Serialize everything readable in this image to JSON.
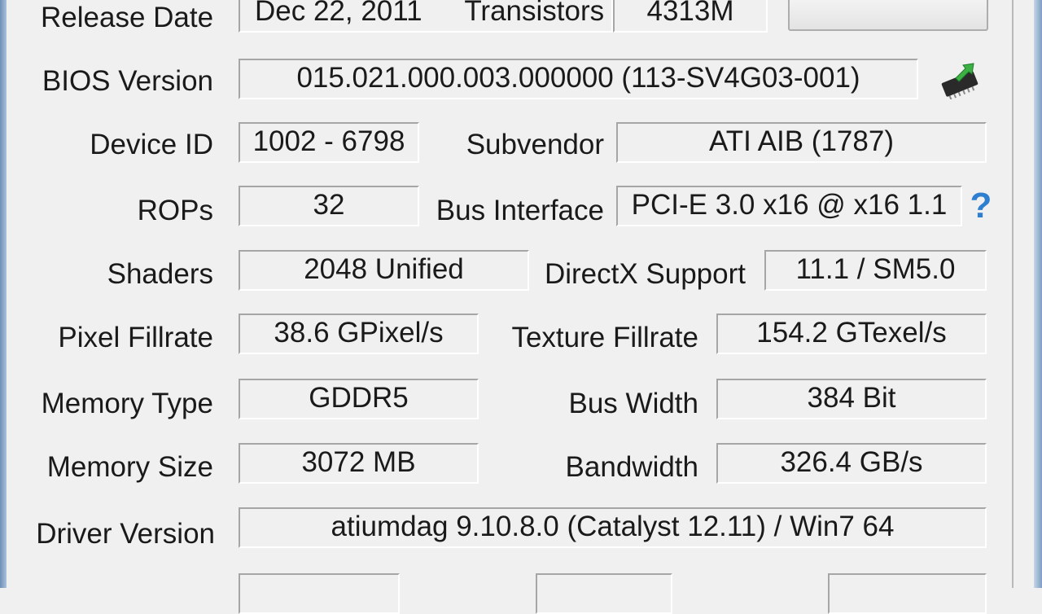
{
  "release": {
    "label": "Release Date",
    "value": "Dec 22, 2011"
  },
  "transistors": {
    "label": "Transistors",
    "value": "4313M"
  },
  "bios": {
    "label": "BIOS Version",
    "value": "015.021.000.003.000000 (113-SV4G03-001)",
    "icon": "bios-save-chip-icon"
  },
  "device_id": {
    "label": "Device ID",
    "value": "1002 - 6798"
  },
  "subvendor": {
    "label": "Subvendor",
    "value": "ATI AIB (1787)"
  },
  "rops": {
    "label": "ROPs",
    "value": "32"
  },
  "bus_interface": {
    "label": "Bus Interface",
    "value": "PCI-E 3.0 x16 @ x16 1.1",
    "help_icon": "?"
  },
  "shaders": {
    "label": "Shaders",
    "value": "2048 Unified"
  },
  "directx": {
    "label": "DirectX Support",
    "value": "11.1 / SM5.0"
  },
  "pixel_fillrate": {
    "label": "Pixel Fillrate",
    "value": "38.6 GPixel/s"
  },
  "texture_fillrate": {
    "label": "Texture Fillrate",
    "value": "154.2 GTexel/s"
  },
  "memory_type": {
    "label": "Memory Type",
    "value": "GDDR5"
  },
  "bus_width": {
    "label": "Bus Width",
    "value": "384 Bit"
  },
  "memory_size": {
    "label": "Memory Size",
    "value": "3072 MB"
  },
  "bandwidth": {
    "label": "Bandwidth",
    "value": "326.4 GB/s"
  },
  "driver": {
    "label": "Driver Version",
    "value": "atiumdag 9.10.8.0 (Catalyst 12.11) / Win7 64"
  },
  "colors": {
    "help": "#2f7fd0",
    "chip": "#2a2a2a",
    "arrow": "#3cb043"
  }
}
